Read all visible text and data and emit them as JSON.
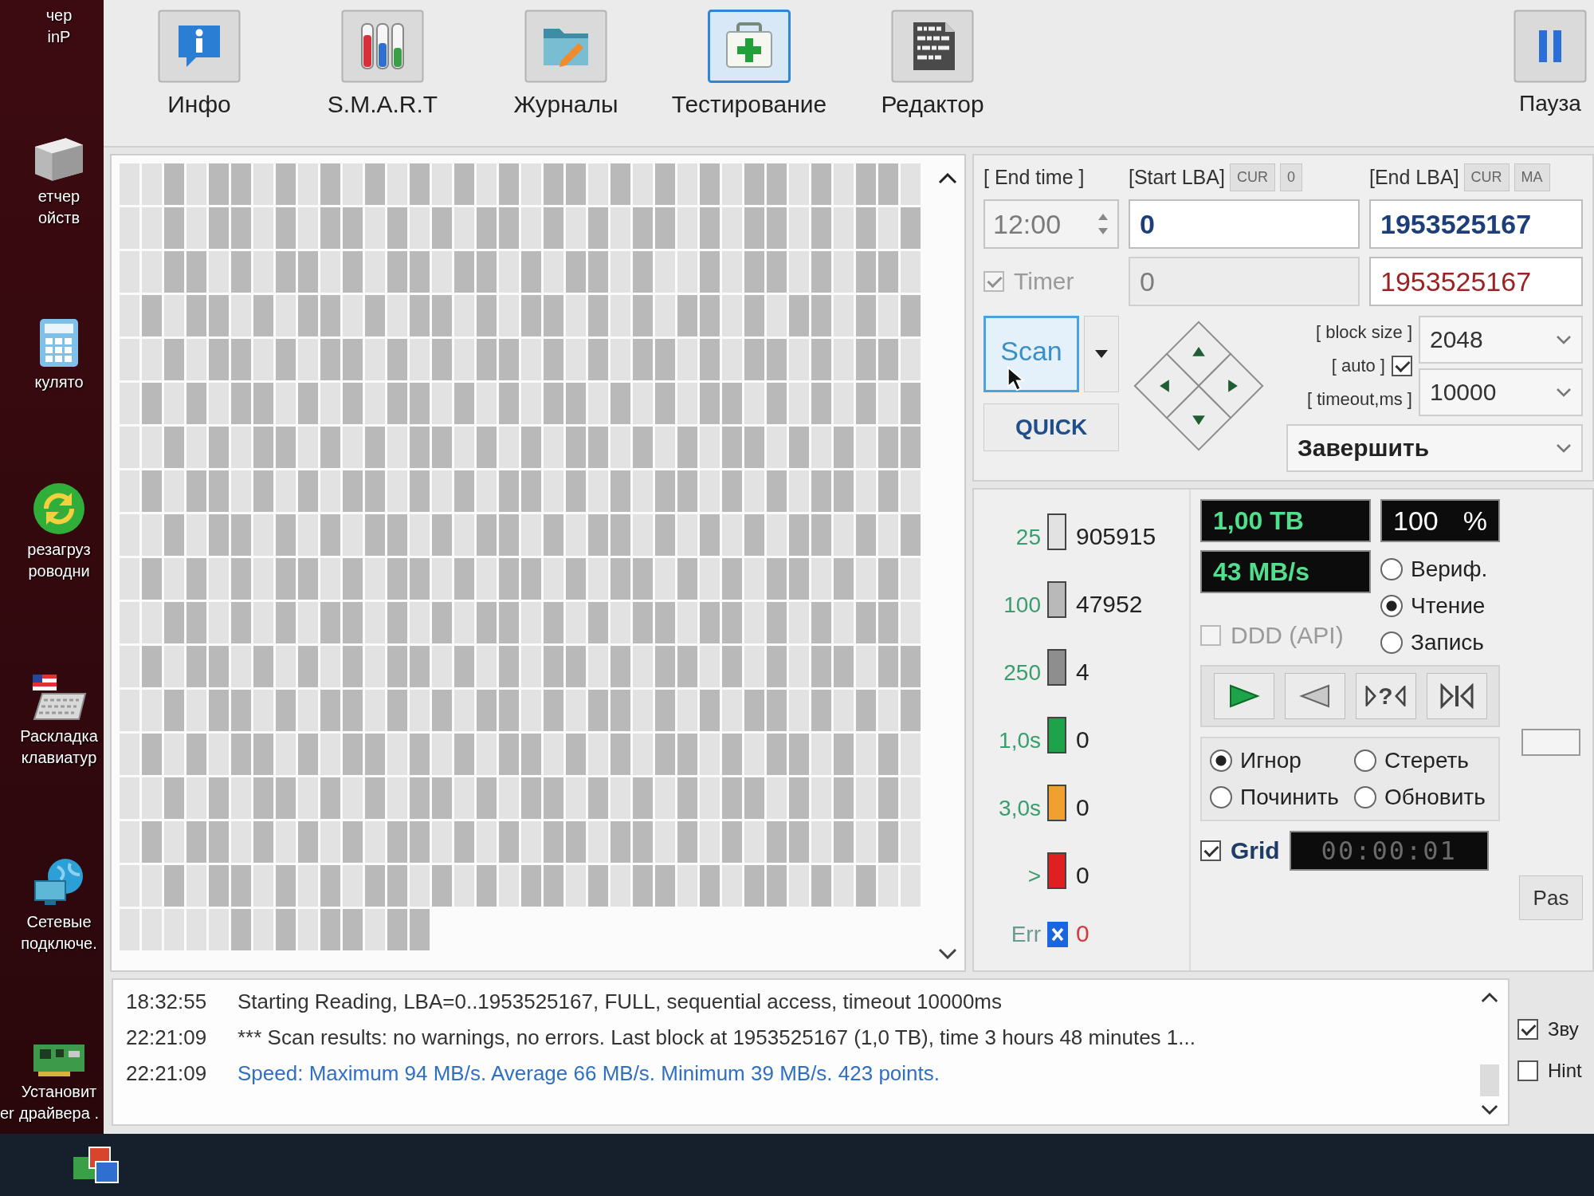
{
  "desktop": {
    "icons": [
      {
        "kind": "none",
        "lines": [
          "чер",
          "inP"
        ]
      },
      {
        "kind": "device",
        "lines": [
          "етчер",
          "ойств"
        ]
      },
      {
        "kind": "calculator",
        "lines": [
          "кулято"
        ]
      },
      {
        "kind": "refresh",
        "lines": [
          "резагруз",
          "роводни"
        ]
      },
      {
        "kind": "keyboard",
        "lines": [
          "Раскладка",
          "клавиатур"
        ]
      },
      {
        "kind": "network",
        "lines": [
          "Сетевые",
          "подключе."
        ]
      },
      {
        "kind": "board",
        "lines": [
          "Установит",
          "драйвера ."
        ],
        "side_text": "er"
      }
    ]
  },
  "toolbar": {
    "tabs": [
      {
        "kind": "info",
        "label": "Инфо",
        "selected": false
      },
      {
        "kind": "smart",
        "label": "S.M.A.R.T",
        "selected": false
      },
      {
        "kind": "logs",
        "label": "Журналы",
        "selected": false
      },
      {
        "kind": "test",
        "label": "Тестирование",
        "selected": true
      },
      {
        "kind": "editor",
        "label": "Редактор",
        "selected": false
      }
    ],
    "pause": {
      "label": "Пауза"
    }
  },
  "block_map": {
    "rows": [
      {
        "above_25ms": [
          false,
          false,
          true,
          false,
          true,
          true,
          false,
          true,
          false,
          true,
          false,
          true,
          false,
          true,
          false,
          true,
          false,
          true,
          false,
          true,
          true,
          false,
          true,
          false,
          true,
          false,
          true,
          false,
          true,
          true,
          false,
          true,
          false,
          true,
          true,
          false
        ]
      },
      {
        "above_25ms": [
          false,
          false,
          true,
          false,
          true,
          true,
          false,
          true,
          false,
          true,
          true,
          false,
          true,
          false,
          true,
          false,
          true,
          true,
          false,
          true,
          false,
          true,
          false,
          true,
          true,
          false,
          true,
          false,
          true,
          true,
          false,
          true,
          false,
          true,
          false,
          true
        ]
      },
      {
        "above_25ms": [
          false,
          false,
          true,
          true,
          false,
          true,
          false,
          true,
          true,
          false,
          true,
          false,
          true,
          true,
          false,
          true,
          true,
          false,
          true,
          false,
          true,
          true,
          false,
          true,
          false,
          false,
          true,
          false,
          true,
          true,
          false,
          true,
          false,
          true,
          true,
          false
        ]
      },
      {
        "above_25ms": [
          false,
          true,
          false,
          true,
          true,
          false,
          true,
          false,
          true,
          true,
          false,
          true,
          false,
          true,
          true,
          false,
          true,
          false,
          true,
          true,
          false,
          true,
          false,
          true,
          false,
          true,
          true,
          false,
          true,
          false,
          true,
          true,
          false,
          true,
          false,
          true
        ]
      },
      {
        "above_25ms": [
          false,
          false,
          true,
          false,
          true,
          true,
          false,
          true,
          false,
          true,
          true,
          false,
          true,
          false,
          true,
          false,
          true,
          true,
          false,
          true,
          false,
          true,
          false,
          true,
          true,
          false,
          true,
          false,
          true,
          true,
          false,
          true,
          false,
          true,
          true,
          false
        ]
      },
      {
        "above_25ms": [
          false,
          true,
          false,
          true,
          false,
          true,
          true,
          false,
          true,
          false,
          true,
          false,
          true,
          true,
          false,
          true,
          false,
          true,
          false,
          true,
          true,
          false,
          true,
          false,
          true,
          false,
          true,
          true,
          false,
          true,
          false,
          true,
          false,
          true,
          false,
          true
        ]
      },
      {
        "above_25ms": [
          false,
          false,
          true,
          false,
          true,
          false,
          true,
          true,
          false,
          true,
          false,
          true,
          false,
          true,
          true,
          false,
          true,
          false,
          true,
          false,
          true,
          true,
          false,
          true,
          false,
          true,
          false,
          true,
          true,
          false,
          true,
          false,
          true,
          false,
          true,
          true
        ]
      },
      {
        "above_25ms": [
          false,
          true,
          false,
          true,
          true,
          false,
          true,
          false,
          true,
          false,
          true,
          true,
          false,
          true,
          false,
          true,
          false,
          true,
          true,
          false,
          true,
          false,
          true,
          false,
          true,
          true,
          false,
          true,
          false,
          true,
          false,
          true,
          true,
          false,
          true,
          false
        ]
      },
      {
        "above_25ms": [
          false,
          false,
          true,
          false,
          true,
          true,
          false,
          true,
          false,
          true,
          false,
          true,
          true,
          false,
          true,
          false,
          true,
          true,
          false,
          true,
          false,
          true,
          true,
          false,
          true,
          false,
          true,
          false,
          true,
          false,
          true,
          true,
          false,
          true,
          false,
          true
        ]
      },
      {
        "above_25ms": [
          false,
          true,
          false,
          true,
          false,
          true,
          false,
          true,
          true,
          false,
          true,
          false,
          true,
          true,
          false,
          true,
          false,
          true,
          true,
          false,
          true,
          false,
          true,
          true,
          false,
          true,
          false,
          true,
          false,
          true,
          true,
          false,
          true,
          false,
          true,
          false
        ]
      },
      {
        "above_25ms": [
          false,
          false,
          true,
          true,
          false,
          true,
          false,
          true,
          false,
          true,
          true,
          false,
          true,
          false,
          true,
          false,
          true,
          true,
          false,
          true,
          false,
          true,
          false,
          true,
          true,
          false,
          true,
          true,
          false,
          true,
          false,
          true,
          false,
          true,
          true,
          false
        ]
      },
      {
        "above_25ms": [
          false,
          true,
          false,
          true,
          true,
          false,
          true,
          false,
          true,
          false,
          true,
          false,
          true,
          true,
          false,
          true,
          false,
          true,
          false,
          true,
          true,
          false,
          true,
          false,
          true,
          true,
          false,
          true,
          false,
          true,
          false,
          true,
          true,
          false,
          true,
          true
        ]
      },
      {
        "above_25ms": [
          false,
          false,
          true,
          false,
          true,
          true,
          false,
          true,
          false,
          true,
          true,
          false,
          true,
          false,
          true,
          false,
          true,
          true,
          false,
          true,
          false,
          true,
          true,
          false,
          true,
          false,
          true,
          false,
          true,
          true,
          false,
          true,
          false,
          true,
          false,
          true
        ]
      },
      {
        "above_25ms": [
          false,
          true,
          false,
          true,
          false,
          true,
          true,
          false,
          true,
          false,
          true,
          true,
          false,
          true,
          false,
          true,
          false,
          true,
          true,
          false,
          true,
          false,
          true,
          false,
          true,
          true,
          false,
          true,
          false,
          true,
          true,
          false,
          true,
          false,
          true,
          false
        ]
      },
      {
        "above_25ms": [
          false,
          false,
          true,
          false,
          true,
          false,
          true,
          true,
          false,
          true,
          false,
          true,
          false,
          true,
          true,
          false,
          true,
          false,
          true,
          true,
          false,
          true,
          false,
          true,
          false,
          true,
          false,
          true,
          true,
          false,
          true,
          false,
          true,
          false,
          true,
          false
        ]
      },
      {
        "above_25ms": [
          false,
          true,
          false,
          true,
          true,
          false,
          true,
          false,
          true,
          false,
          true,
          false,
          true,
          true,
          false,
          true,
          false,
          true,
          false,
          true,
          true,
          false,
          true,
          true,
          false,
          true,
          false,
          true,
          false,
          true,
          true,
          false,
          true,
          false,
          true,
          false
        ]
      },
      {
        "above_25ms": [
          false,
          false,
          true,
          false,
          true,
          true,
          false,
          true,
          false,
          true,
          false,
          true,
          true,
          false,
          true,
          false,
          true,
          false,
          true,
          true,
          false,
          true,
          false,
          true,
          true,
          false,
          true,
          false,
          true,
          true,
          false,
          true,
          false,
          true,
          false,
          false
        ]
      },
      {
        "above_25ms": [
          false,
          false,
          false,
          false,
          false,
          true,
          false,
          true,
          false,
          true,
          true,
          false,
          true,
          true
        ]
      }
    ]
  },
  "scan_settings": {
    "end_time": {
      "label": "[ End time ]",
      "value": "12:00",
      "disabled": true
    },
    "timer": {
      "label": "Timer",
      "checked": true,
      "disabled": true
    },
    "start_lba": {
      "label": "[Start LBA]",
      "buttons": [
        "CUR",
        "0"
      ],
      "fields": [
        {
          "kind": "range",
          "value": "0",
          "disabled": false
        },
        {
          "kind": "current",
          "value": "0",
          "disabled": true
        }
      ]
    },
    "end_lba": {
      "label": "[End LBA]",
      "buttons": [
        "CUR",
        "MA"
      ],
      "fields": [
        {
          "kind": "range",
          "value": "1953525167",
          "disabled": false
        },
        {
          "kind": "current",
          "value": "1953525167",
          "disabled": false
        }
      ]
    },
    "scan_button": "Scan",
    "quick_button": "QUICK",
    "block_size": {
      "label": "[ block size ]",
      "value": "2048"
    },
    "auto": {
      "label": "[ auto ]",
      "checked": true
    },
    "timeout": {
      "label": "[ timeout,ms ]",
      "value": "10000"
    },
    "finish_action": "Завершить"
  },
  "legend": [
    {
      "kind": "time",
      "label": "25",
      "color": "#e2e2e2",
      "count": "905915"
    },
    {
      "kind": "time",
      "label": "100",
      "color": "#b9b9b9",
      "count": "47952"
    },
    {
      "kind": "time",
      "label": "250",
      "color": "#8e8e8e",
      "count": "4"
    },
    {
      "kind": "time",
      "label": "1,0s",
      "color": "#1fa34a",
      "count": "0"
    },
    {
      "kind": "time",
      "label": "3,0s",
      "color": "#f0a030",
      "count": "0"
    },
    {
      "kind": "time",
      "label": ">",
      "color": "#e02020",
      "count": "0"
    },
    {
      "kind": "error",
      "label": "Err",
      "color": "#1a66e0",
      "count": "0"
    }
  ],
  "readouts": {
    "capacity": "1,00 TB",
    "percent": {
      "value": "100",
      "unit": "%"
    },
    "speed": "43 MB/s"
  },
  "mode": [
    {
      "label": "Вериф.",
      "selected": false
    },
    {
      "label": "Чтение",
      "selected": true
    },
    {
      "label": "Запись",
      "selected": false
    }
  ],
  "ddd_api": {
    "label": "DDD (API)",
    "checked": false,
    "disabled": true
  },
  "player": {
    "jump_label": "?"
  },
  "on_error": [
    {
      "label": "Игнор",
      "selected": true
    },
    {
      "label": "Стереть",
      "selected": false
    },
    {
      "label": "Починить",
      "selected": false
    },
    {
      "label": "Обновить",
      "selected": false
    }
  ],
  "grid_toggle": {
    "label": "Grid",
    "checked": true
  },
  "elapsed": "00:00:01",
  "side_panel": {
    "button": "Pas"
  },
  "log": [
    {
      "kind": "info",
      "time": "18:32:55",
      "text": "Starting Reading, LBA=0..1953525167, FULL, sequential access, timeout 10000ms"
    },
    {
      "kind": "info",
      "time": "22:21:09",
      "text": "*** Scan results: no warnings, no errors. Last block at 1953525167 (1,0 TB), time 3 hours 48 minutes 1..."
    },
    {
      "kind": "speed",
      "time": "22:21:09",
      "text": "Speed: Maximum 94 MB/s. Average 66 MB/s. Minimum 39 MB/s. 423 points."
    }
  ],
  "log_options": [
    {
      "label": "Зву",
      "checked": true
    },
    {
      "label": "Hint",
      "checked": false
    }
  ]
}
